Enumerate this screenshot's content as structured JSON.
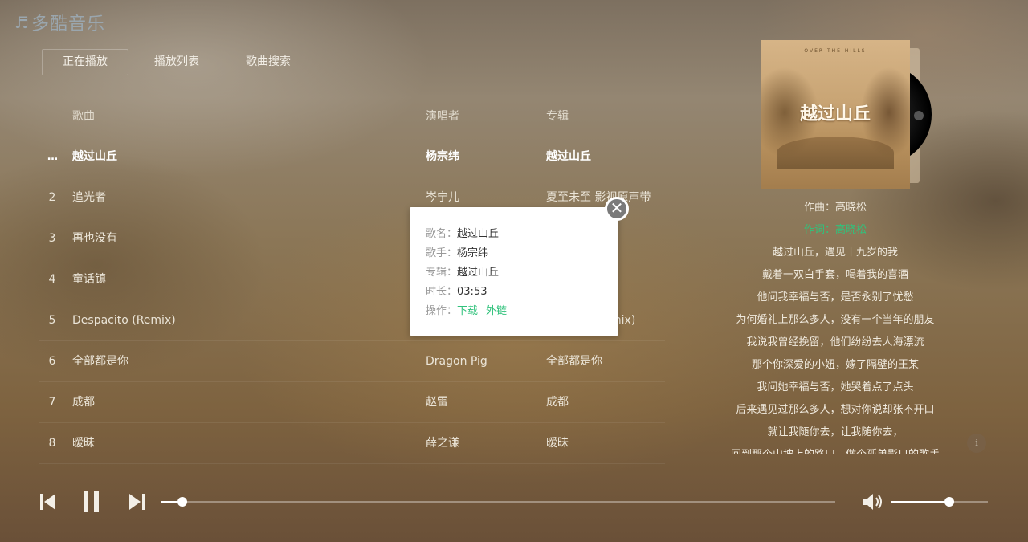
{
  "app": {
    "logo_note": "♬",
    "logo_text": "多酷音乐"
  },
  "tabs": [
    {
      "label": "正在播放",
      "active": true
    },
    {
      "label": "播放列表",
      "active": false
    },
    {
      "label": "歌曲搜索",
      "active": false
    }
  ],
  "list": {
    "headers": {
      "song": "歌曲",
      "artist": "演唱者",
      "album": "专辑"
    },
    "rows": [
      {
        "num": "...",
        "song": "越过山丘",
        "artist": "杨宗纬",
        "album": "越过山丘",
        "playing": true
      },
      {
        "num": "2",
        "song": "追光者",
        "artist": "岑宁儿",
        "album": "夏至未至 影视原声带"
      },
      {
        "num": "3",
        "song": "再也没有",
        "artist": "",
        "album": ""
      },
      {
        "num": "4",
        "song": "童话镇",
        "artist": "",
        "album": ""
      },
      {
        "num": "5",
        "song": "Despacito (Remix)",
        "artist": "",
        "album": "mix)"
      },
      {
        "num": "6",
        "song": "全部都是你",
        "artist": "Dragon Pig",
        "album": "全部都是你"
      },
      {
        "num": "7",
        "song": "成都",
        "artist": "赵雷",
        "album": "成都"
      },
      {
        "num": "8",
        "song": "暧昧",
        "artist": "薛之谦",
        "album": "暧昧"
      }
    ]
  },
  "popup": {
    "name_label": "歌名：",
    "name": "越过山丘",
    "singer_label": "歌手：",
    "singer": "杨宗纬",
    "album_label": "专辑：",
    "album": "越过山丘",
    "duration_label": "时长：",
    "duration": "03:53",
    "actions_label": "操作：",
    "download": "下载",
    "external_link": "外链",
    "close_glyph": "✕"
  },
  "album_art": {
    "top_text": "OVER THE HILLS",
    "title": "越过山丘"
  },
  "lyrics": [
    {
      "text": "作曲：高晓松"
    },
    {
      "text": "作词：高晓松",
      "active": true
    },
    {
      "text": "越过山丘，遇见十九岁的我"
    },
    {
      "text": "戴着一双白手套，喝着我的喜酒"
    },
    {
      "text": "他问我幸福与否，是否永别了忧愁"
    },
    {
      "text": "为何婚礼上那么多人，没有一个当年的朋友"
    },
    {
      "text": "我说我曾经挽留，他们纷纷去人海漂流"
    },
    {
      "text": "那个你深爱的小妞，嫁了隔壁的王某"
    },
    {
      "text": "我问她幸福与否，她哭着点了点头"
    },
    {
      "text": "后来遇见过那么多人，想对你说却张不开口"
    },
    {
      "text": "就让我随你去，让我随你去，"
    },
    {
      "text": "回到那个山坡上的路口，做个孤单影只的歌手"
    }
  ],
  "info_button": "i",
  "player": {
    "progress_fraction": 0.032,
    "volume_fraction": 0.6,
    "accent_color": "#31c27c"
  }
}
